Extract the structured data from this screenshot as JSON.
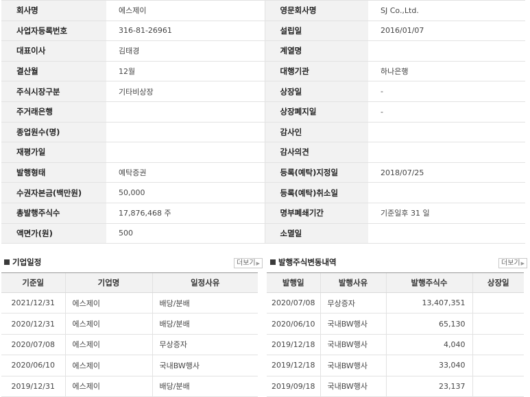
{
  "info_rows": [
    {
      "l1": "회사명",
      "v1": "에스제이",
      "l2": "영문회사명",
      "v2": "SJ Co.,Ltd."
    },
    {
      "l1": "사업자등록번호",
      "v1": "316-81-26961",
      "l2": "설립일",
      "v2": "2016/01/07"
    },
    {
      "l1": "대표이사",
      "v1": "김태경",
      "l2": "계열명",
      "v2": ""
    },
    {
      "l1": "결산월",
      "v1": "12월",
      "l2": "대행기관",
      "v2": "하나은행"
    },
    {
      "l1": "주식시장구분",
      "v1": "기타비상장",
      "l2": "상장일",
      "v2": "-"
    },
    {
      "l1": "주거래은행",
      "v1": "",
      "l2": "상장폐지일",
      "v2": "-"
    },
    {
      "l1": "종업원수(명)",
      "v1": "",
      "l2": "감사인",
      "v2": ""
    },
    {
      "l1": "재평가일",
      "v1": "",
      "l2": "감사의견",
      "v2": ""
    },
    {
      "l1": "발행형태",
      "v1": "예탁증권",
      "l2": "등록(예탁)지정일",
      "v2": "2018/07/25"
    },
    {
      "l1": "수권자본금(백만원)",
      "v1": "50,000",
      "l2": "등록(예탁)취소일",
      "v2": ""
    },
    {
      "l1": "총발행주식수",
      "v1": "17,876,468 주",
      "l2": "명부폐쇄기간",
      "v2": "기준일후 31 일"
    },
    {
      "l1": "액면가(원)",
      "v1": "500",
      "l2": "소멸일",
      "v2": ""
    }
  ],
  "schedule": {
    "title": "기업일정",
    "more": "더보기",
    "headers": [
      "기준일",
      "기업명",
      "일정사유"
    ],
    "rows": [
      [
        "2021/12/31",
        "에스제이",
        "배당/분배"
      ],
      [
        "2020/12/31",
        "에스제이",
        "배당/분배"
      ],
      [
        "2020/07/08",
        "에스제이",
        "무상증자"
      ],
      [
        "2020/06/10",
        "에스제이",
        "국내BW행사"
      ],
      [
        "2019/12/31",
        "에스제이",
        "배당/분배"
      ]
    ]
  },
  "shares": {
    "title": "발행주식변동내역",
    "more": "더보기",
    "headers": [
      "발행일",
      "발행사유",
      "발행주식수",
      "상장일"
    ],
    "rows": [
      [
        "2020/07/08",
        "무상증자",
        "13,407,351",
        ""
      ],
      [
        "2020/06/10",
        "국내BW행사",
        "65,130",
        ""
      ],
      [
        "2019/12/18",
        "국내BW행사",
        "4,040",
        ""
      ],
      [
        "2019/12/18",
        "국내BW행사",
        "33,040",
        ""
      ],
      [
        "2019/09/18",
        "국내BW행사",
        "23,137",
        ""
      ]
    ]
  }
}
